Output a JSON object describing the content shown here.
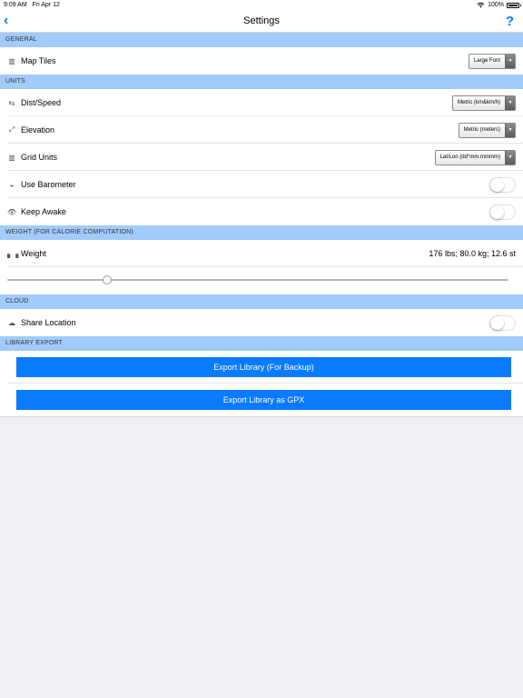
{
  "status": {
    "time": "9:09 AM",
    "date": "Fri Apr 12",
    "battery": "100%"
  },
  "nav": {
    "title": "Settings",
    "back_icon": "chevron-left-icon",
    "help_label": "?"
  },
  "sections": {
    "general": "GENERAL",
    "units": "UNITS",
    "weight": "WEIGHT (FOR CALORIE COMPUTATION)",
    "cloud": "CLOUD",
    "library_export": "LIBRARY EXPORT"
  },
  "map_tiles": {
    "label": "Map Tiles",
    "value": "Large Font"
  },
  "dist_speed": {
    "label": "Dist/Speed",
    "value": "Metric (km&km/h)"
  },
  "elevation": {
    "label": "Elevation",
    "value": "Metric (meters)"
  },
  "grid_units": {
    "label": "Grid Units",
    "value": "Lat/Lon (dd°mm.mmmm)"
  },
  "use_barometer": {
    "label": "Use Barometer",
    "on": false
  },
  "keep_awake": {
    "label": "Keep Awake",
    "on": false
  },
  "weight": {
    "label": "Weight",
    "value": "176 lbs; 80.0 kg; 12.6 st",
    "slider_fraction": 0.2
  },
  "share_location": {
    "label": "Share Location",
    "on": false
  },
  "buttons": {
    "export_backup": "Export Library (For Backup)",
    "export_gpx": "Export Library as GPX"
  },
  "colors": {
    "accent": "#0a7aff",
    "section_header": "#a2cbfd",
    "background": "#efeff4"
  }
}
